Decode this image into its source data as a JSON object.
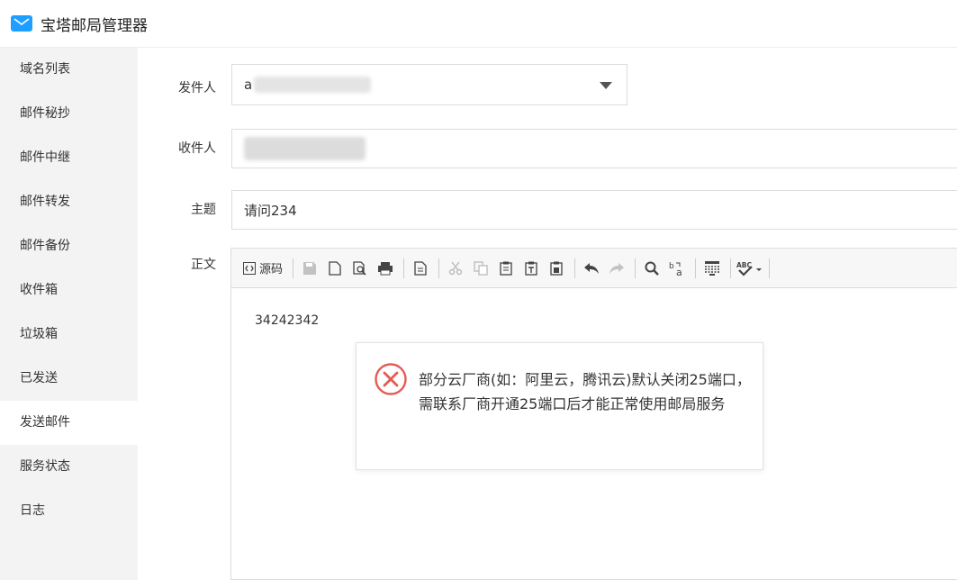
{
  "app": {
    "title": "宝塔邮局管理器"
  },
  "sidebar": {
    "items": [
      {
        "label": "域名列表"
      },
      {
        "label": "邮件秘抄"
      },
      {
        "label": "邮件中继"
      },
      {
        "label": "邮件转发"
      },
      {
        "label": "邮件备份"
      },
      {
        "label": "收件箱"
      },
      {
        "label": "垃圾箱"
      },
      {
        "label": "已发送"
      },
      {
        "label": "发送邮件",
        "active": true
      },
      {
        "label": "服务状态"
      },
      {
        "label": "日志"
      }
    ]
  },
  "form": {
    "sender": {
      "label": "发件人",
      "value": "a"
    },
    "recipient": {
      "label": "收件人"
    },
    "subject": {
      "label": "主题",
      "value": "请问234"
    },
    "body": {
      "label": "正文",
      "content": "34242342"
    }
  },
  "toolbar": {
    "source_label": "源码"
  },
  "dialog": {
    "message": "部分云厂商(如：阿里云，腾讯云)默认关闭25端口，需联系厂商开通25端口后才能正常使用邮局服务"
  },
  "icons": {
    "app": "mail-icon",
    "error": "error-circle-icon"
  },
  "colors": {
    "accent": "#1e9fff",
    "error": "#e55b53"
  }
}
